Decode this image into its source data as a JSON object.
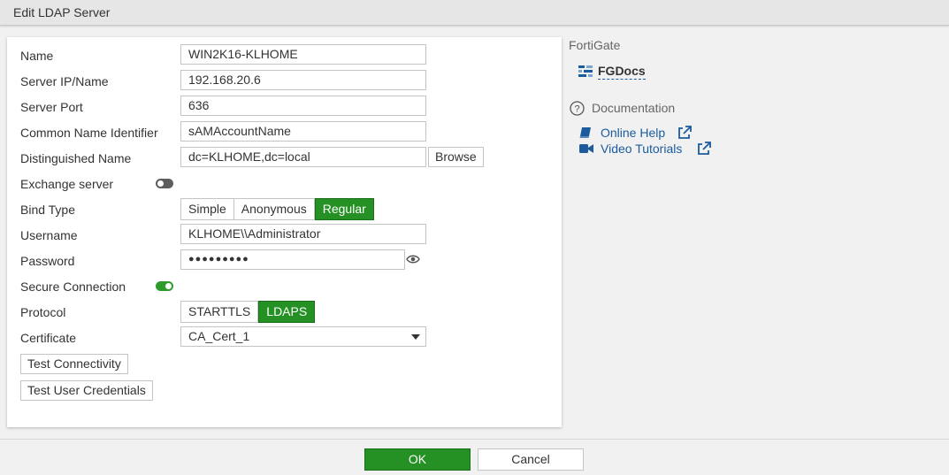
{
  "window": {
    "title": "Edit LDAP Server"
  },
  "form": {
    "name": {
      "label": "Name",
      "value": "WIN2K16-KLHOME"
    },
    "server_ip": {
      "label": "Server IP/Name",
      "value": "192.168.20.6"
    },
    "server_port": {
      "label": "Server Port",
      "value": "636"
    },
    "cn_identifier": {
      "label": "Common Name Identifier",
      "value": "sAMAccountName"
    },
    "distinguished_name": {
      "label": "Distinguished Name",
      "value": "dc=KLHOME,dc=local",
      "browse_label": "Browse"
    },
    "exchange_server": {
      "label": "Exchange server",
      "enabled": false
    },
    "bind_type": {
      "label": "Bind Type",
      "options": [
        "Simple",
        "Anonymous",
        "Regular"
      ],
      "selected": "Regular"
    },
    "username": {
      "label": "Username",
      "value": "KLHOME\\\\Administrator"
    },
    "password": {
      "label": "Password",
      "value": "●●●●●●●●●"
    },
    "secure_connection": {
      "label": "Secure Connection",
      "enabled": true
    },
    "protocol": {
      "label": "Protocol",
      "options": [
        "STARTTLS",
        "LDAPS"
      ],
      "selected": "LDAPS"
    },
    "certificate": {
      "label": "Certificate",
      "value": "CA_Cert_1"
    },
    "test_connectivity_label": "Test Connectivity",
    "test_user_credentials_label": "Test User Credentials"
  },
  "sidebar": {
    "section_title": "FortiGate",
    "fgdocs_label": "FGDocs",
    "documentation_title": "Documentation",
    "online_help_label": "Online Help",
    "video_tutorials_label": "Video Tutorials"
  },
  "footer": {
    "ok_label": "OK",
    "cancel_label": "Cancel"
  },
  "colors": {
    "accent_green": "#259124",
    "link_blue": "#1b5b9e"
  }
}
